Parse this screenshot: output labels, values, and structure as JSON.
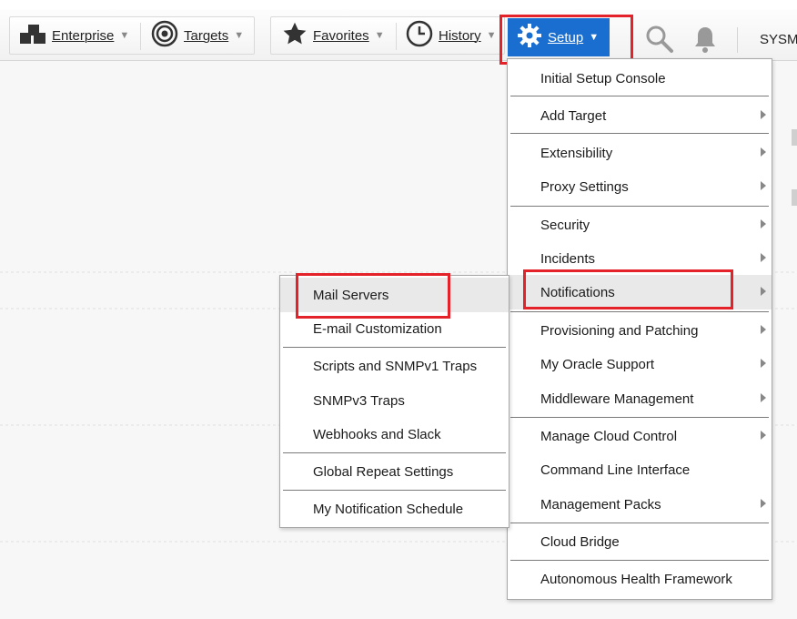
{
  "toolbar": {
    "enterprise": "Enterprise",
    "targets": "Targets",
    "favorites": "Favorites",
    "history": "History",
    "setup": "Setup",
    "user": "SYSM"
  },
  "icons": {
    "enterprise": "enterprise-icon",
    "targets": "targets-icon",
    "favorites": "star-icon",
    "history": "clock-icon",
    "setup": "gear-icon",
    "search": "search-icon",
    "notifications": "bell-icon"
  },
  "colors": {
    "accent": "#1a6ecf",
    "highlight": "#e3222a"
  },
  "setup_menu": [
    {
      "label": "Initial Setup Console",
      "submenu": false
    },
    {
      "label": "Add Target",
      "submenu": true
    },
    {
      "label": "Extensibility",
      "submenu": true
    },
    {
      "label": "Proxy Settings",
      "submenu": true
    },
    {
      "label": "Security",
      "submenu": true
    },
    {
      "label": "Incidents",
      "submenu": true
    },
    {
      "label": "Notifications",
      "submenu": true
    },
    {
      "label": "Provisioning and Patching",
      "submenu": true
    },
    {
      "label": "My Oracle Support",
      "submenu": true
    },
    {
      "label": "Middleware Management",
      "submenu": true
    },
    {
      "label": "Manage Cloud Control",
      "submenu": true
    },
    {
      "label": "Command Line Interface",
      "submenu": false
    },
    {
      "label": "Management Packs",
      "submenu": true
    },
    {
      "label": "Cloud Bridge",
      "submenu": false
    },
    {
      "label": "Autonomous Health Framework",
      "submenu": false
    }
  ],
  "notifications_menu": [
    {
      "label": "Mail Servers"
    },
    {
      "label": "E-mail Customization"
    },
    {
      "label": "Scripts and SNMPv1 Traps"
    },
    {
      "label": "SNMPv3 Traps"
    },
    {
      "label": "Webhooks and Slack"
    },
    {
      "label": "Global Repeat Settings"
    },
    {
      "label": "My Notification Schedule"
    }
  ]
}
